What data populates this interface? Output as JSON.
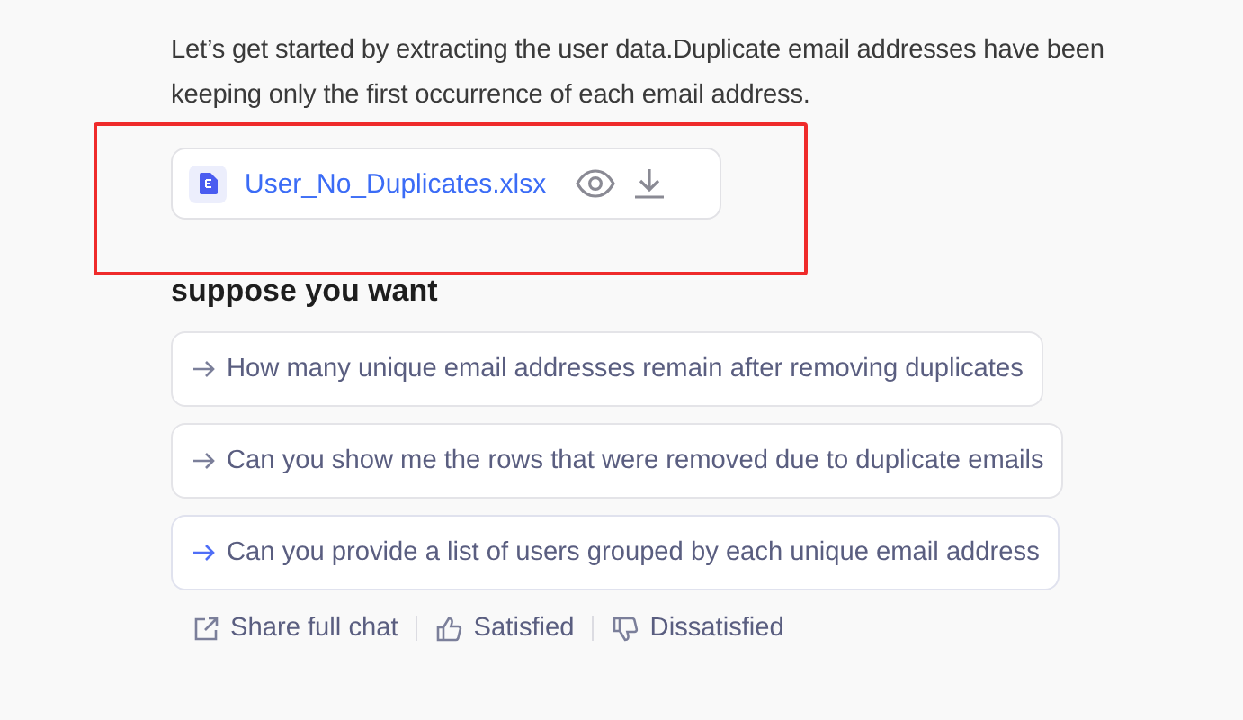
{
  "message": {
    "lines": [
      "Let’s get started by extracting the user data.Duplicate email addresses have been",
      "keeping only the first occurrence of each email address."
    ]
  },
  "file": {
    "name": "User_No_Duplicates.xlsx",
    "highlighted": true
  },
  "suggestions": {
    "title": "suppose you want",
    "items": [
      {
        "text": "How many unique email addresses remain after removing duplicates",
        "hovered": false
      },
      {
        "text": "Can you show me the rows that were removed due to duplicate emails",
        "hovered": false
      },
      {
        "text": "Can you provide a list of users grouped by each unique email address",
        "hovered": true
      }
    ]
  },
  "actions": [
    {
      "kind": "share",
      "label": "Share full chat"
    },
    {
      "kind": "like",
      "label": "Satisfied"
    },
    {
      "kind": "dislike",
      "label": "Dissatisfied"
    }
  ]
}
